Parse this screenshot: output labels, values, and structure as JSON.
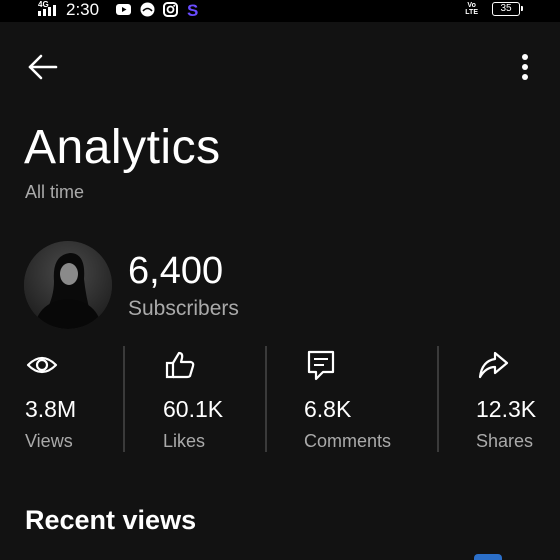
{
  "status_bar": {
    "network": "4G",
    "time": "2:30",
    "volte": "Vo\nLTE",
    "battery": "35",
    "app_icons": [
      "youtube-icon",
      "message-bubble-icon",
      "instagram-icon",
      "s-app-icon"
    ]
  },
  "header": {
    "title": "Analytics",
    "subtitle": "All time"
  },
  "channel": {
    "subscriber_count": "6,400",
    "subscriber_label": "Subscribers"
  },
  "stats": [
    {
      "icon": "eye-icon",
      "value": "3.8M",
      "label": "Views"
    },
    {
      "icon": "thumbs-up-icon",
      "value": "60.1K",
      "label": "Likes"
    },
    {
      "icon": "comment-icon",
      "value": "6.8K",
      "label": "Comments"
    },
    {
      "icon": "share-icon",
      "value": "12.3K",
      "label": "Shares"
    }
  ],
  "sections": {
    "recent_views": "Recent views"
  },
  "colors": {
    "background": "#121212",
    "status_bar": "#000000",
    "text_primary": "#ffffff",
    "text_secondary": "#aaaaaa",
    "divider": "#3a3a3a",
    "accent": "#2b6fc9"
  }
}
